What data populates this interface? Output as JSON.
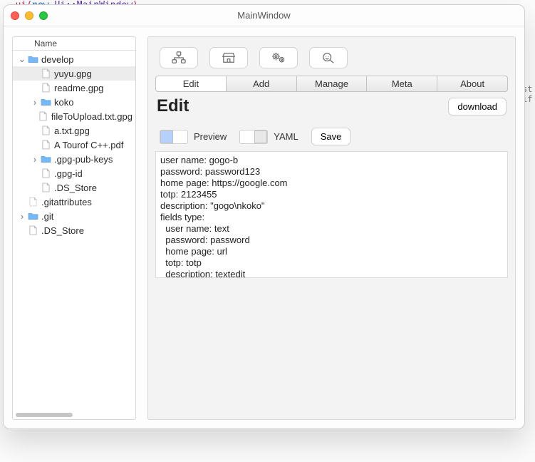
{
  "background_code": {
    "prefix": ", ",
    "kw1": "ui",
    "paren_open": "(",
    "kw2": "new",
    "ns": " Ui::",
    "mw": "MainWindow",
    "paren_close": ")"
  },
  "side_marks": {
    "a": "st",
    "b": "if"
  },
  "window": {
    "title": "MainWindow"
  },
  "tree": {
    "header": "Name",
    "items": [
      {
        "depth": 0,
        "label": "develop",
        "kind": "folder",
        "exp": "open",
        "sel": false
      },
      {
        "depth": 1,
        "label": "yuyu.gpg",
        "kind": "file",
        "sel": true
      },
      {
        "depth": 1,
        "label": "readme.gpg",
        "kind": "file",
        "sel": false
      },
      {
        "depth": 1,
        "label": "koko",
        "kind": "folder",
        "exp": "closed",
        "sel": false
      },
      {
        "depth": 1,
        "label": "fileToUpload.txt.gpg",
        "kind": "file",
        "sel": false
      },
      {
        "depth": 1,
        "label": "a.txt.gpg",
        "kind": "file",
        "sel": false
      },
      {
        "depth": 1,
        "label": "A Tourof C++.pdf",
        "kind": "file",
        "sel": false
      },
      {
        "depth": 1,
        "label": ".gpg-pub-keys",
        "kind": "folder",
        "exp": "closed",
        "sel": false
      },
      {
        "depth": 1,
        "label": ".gpg-id",
        "kind": "file",
        "sel": false
      },
      {
        "depth": 1,
        "label": ".DS_Store",
        "kind": "file",
        "sel": false
      },
      {
        "depth": 0,
        "label": ".gitattributes",
        "kind": "file-dotted",
        "sel": false
      },
      {
        "depth": 0,
        "label": ".git",
        "kind": "folder",
        "exp": "closed",
        "sel": false
      },
      {
        "depth": 0,
        "label": ".DS_Store",
        "kind": "file",
        "sel": false
      }
    ]
  },
  "toolbar_icons": [
    "tree-icon",
    "store-icon",
    "gears-icon",
    "search-icon"
  ],
  "tabs": {
    "items": [
      "Edit",
      "Add",
      "Manage",
      "Meta",
      "About"
    ],
    "active_index": 0
  },
  "heading": "Edit",
  "download_label": "download",
  "options": {
    "preview_label": "Preview",
    "yaml_label": "YAML",
    "save_label": "Save"
  },
  "editor_text": "user name: gogo-b\npassword: password123\nhome page: https://google.com\ntotp: 2123455\ndescription: \"gogo\\nkoko\"\nfields type:\n  user name: text\n  password: password\n  home page: url\n  totp: totp\n  description: textedit"
}
